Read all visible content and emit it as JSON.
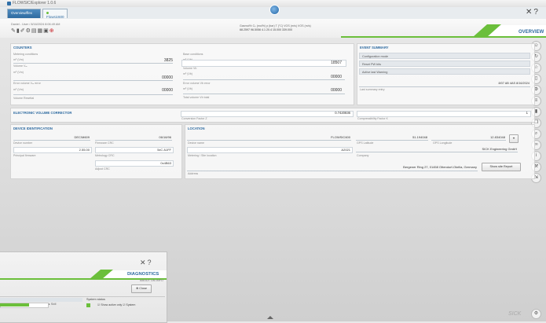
{
  "window": {
    "title": "FLOWSIC/Explorer 1.0.6"
  },
  "tabs": [
    {
      "label": "Overview/flex"
    },
    {
      "label": "Flowsic600 - 5811168070"
    }
  ],
  "header": {
    "info": "Daniel - User  /  8/16/2024  8:06:49 AM",
    "gas": {
      "labels": "Gasmol%  Cₚ (mol%)  p (bar)   T (°C)   VOS (m/s)  VOS (m/s)",
      "values": "68.2597   96.5056     4.1    20.4    15.000   339.000"
    },
    "overview_label": "OVERVIEW"
  },
  "counters": {
    "title": "COUNTERS",
    "metering": {
      "title": "Metering conditions",
      "v_label": "Volume  Vₘ",
      "v_value": "3825",
      "err_label": "Error volume  Vₘ error",
      "err_value": "00000",
      "err2_value": "00000",
      "resettable": "Volume Resettal"
    },
    "base": {
      "title": "Base conditions",
      "v_label": "Volume  Vb",
      "v_value": "18507",
      "err_label": "Error volume  Vb error",
      "err_value": "00000",
      "total_label": "Total volume  Vb total",
      "total_value": "00000"
    }
  },
  "event_summary": {
    "title": "EVENT SUMMARY",
    "items": [
      "Configuration mode",
      "Reset PW bits",
      "Active last Warning"
    ],
    "timestamp": "8/07 AB 4AS  8/16/2024",
    "last_entry": "Last summary entry"
  },
  "evc": {
    "title": "ELECTRONIC VOLUME CORRECTOR",
    "conv_value": "0.7420836",
    "conv_label": "Conversion Factor Z",
    "comp_label": "Compressibility Factor K",
    "comp_value": "1"
  },
  "device": {
    "title": "DEVICE IDENTIFICATION",
    "device_number": "DEC/M609",
    "device_number_label": "Device number",
    "firmware_label": "Firmware CRC",
    "firmware_value": "06/16/96",
    "firmware_value2": "5xC A1FF",
    "principal_label": "Principal firmware",
    "principal_value": "2.55.00",
    "metrology_label": "Metrology CRC",
    "metrology_value": "0x4B63",
    "param_label": "Adjust CRC"
  },
  "location": {
    "title": "LOCATION",
    "device_name": "FLOWSIC600",
    "device_name_label": "Device name",
    "gps_lat": "51.194048",
    "gps_lon": "12.834048",
    "gps_lat_label": "GPS Latitude",
    "gps_lon_label": "GPS Longitude",
    "company": "SICK Engineering GmbH",
    "company_label": "Company",
    "meter": "A2021",
    "meter_label": "Metering / Site location",
    "address": "Bergener Ring 27, 01458 Ottendorf-Okrilla, Germany",
    "address_label": "Address",
    "report_button": "Show site Report"
  },
  "diagnostics": {
    "title": "DIAGNOSTICS",
    "subtitle": "ABOUT UN-INFO",
    "close_label": "Close",
    "status_label": "System status",
    "show_active": "Show active only",
    "system": "System",
    "progress_pct": 0.6
  },
  "brand": "SICK"
}
